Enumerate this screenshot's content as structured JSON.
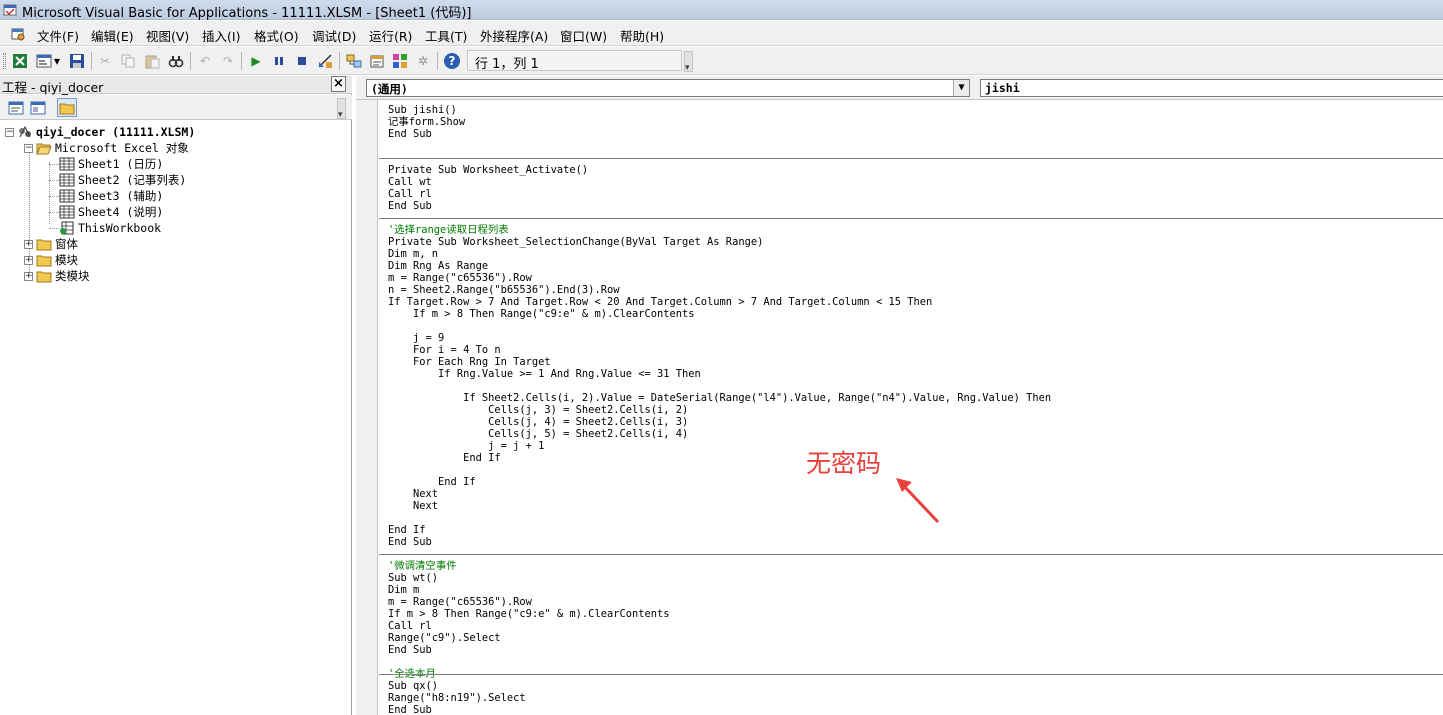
{
  "window": {
    "title": "Microsoft Visual Basic for Applications - 11111.XLSM - [Sheet1 (代码)]"
  },
  "menu": {
    "items": [
      "文件(F)",
      "编辑(E)",
      "视图(V)",
      "插入(I)",
      "格式(O)",
      "调试(D)",
      "运行(R)",
      "工具(T)",
      "外接程序(A)",
      "窗口(W)",
      "帮助(H)"
    ]
  },
  "toolbar": {
    "status": "行 1，列 1",
    "buttons": [
      "excel-icon",
      "insert-userform-icon",
      "save-icon",
      "cut-icon",
      "copy-icon",
      "paste-icon",
      "find-icon",
      "undo-icon",
      "redo-icon",
      "run-icon",
      "break-icon",
      "reset-icon",
      "design-mode-icon",
      "project-explorer-icon",
      "properties-icon",
      "object-browser-icon",
      "toolbox-icon",
      "help-icon"
    ]
  },
  "project": {
    "title": "工程 - qiyi_docer",
    "tree": {
      "root": "qiyi_docer (11111.XLSM)",
      "excel_objects": "Microsoft Excel 对象",
      "sheets": [
        "Sheet1 (日历)",
        "Sheet2 (记事列表)",
        "Sheet3 (辅助)",
        "Sheet4 (说明)",
        "ThisWorkbook"
      ],
      "folders": [
        "窗体",
        "模块",
        "类模块"
      ]
    }
  },
  "code": {
    "object_combo": "(通用)",
    "procedure_combo": "jishi",
    "lines": [
      "Sub jishi()",
      "记事form.Show",
      "End Sub",
      "",
      "",
      "Private Sub Worksheet_Activate()",
      "Call wt",
      "Call rl",
      "End Sub",
      "",
      "'选择range读取日程列表",
      "Private Sub Worksheet_SelectionChange(ByVal Target As Range)",
      "Dim m, n",
      "Dim Rng As Range",
      "m = Range(\"c65536\").Row",
      "n = Sheet2.Range(\"b65536\").End(3).Row",
      "If Target.Row > 7 And Target.Row < 20 And Target.Column > 7 And Target.Column < 15 Then",
      "    If m > 8 Then Range(\"c9:e\" & m).ClearContents",
      "",
      "    j = 9",
      "    For i = 4 To n",
      "    For Each Rng In Target",
      "        If Rng.Value >= 1 And Rng.Value <= 31 Then",
      "",
      "            If Sheet2.Cells(i, 2).Value = DateSerial(Range(\"l4\").Value, Range(\"n4\").Value, Rng.Value) Then",
      "                Cells(j, 3) = Sheet2.Cells(i, 2)",
      "                Cells(j, 4) = Sheet2.Cells(i, 3)",
      "                Cells(j, 5) = Sheet2.Cells(i, 4)",
      "                j = j + 1",
      "            End If",
      "",
      "        End If",
      "    Next",
      "    Next",
      "",
      "End If",
      "End Sub",
      "",
      "'微调清空事件",
      "Sub wt()",
      "Dim m",
      "m = Range(\"c65536\").Row",
      "If m > 8 Then Range(\"c9:e\" & m).ClearContents",
      "Call rl",
      "Range(\"c9\").Select",
      "End Sub",
      "",
      "'全选本月",
      "Sub qx()",
      "Range(\"h8:n19\").Select",
      "End Sub"
    ]
  },
  "annotation": {
    "text": "无密码",
    "color": "#e8403a"
  }
}
